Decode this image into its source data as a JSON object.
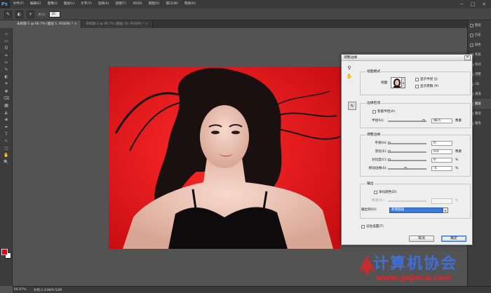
{
  "app": {
    "logo": "Ps"
  },
  "menu": [
    "文件(F)",
    "编辑(E)",
    "图像(I)",
    "图层(L)",
    "文字(Y)",
    "选择(S)",
    "滤镜(T)",
    "3D(D)",
    "视图(V)",
    "窗口(W)",
    "帮助(H)"
  ],
  "window_controls": [
    "−",
    "□",
    "×"
  ],
  "options": {
    "size_label": "大小:",
    "size_value": "35"
  },
  "tabs": [
    {
      "label": "未标题-1 @ 66.7% (图层 1, RGB/8) * ×"
    },
    {
      "label": "未标题-2 @ 66.7% (图层 10, RGB/8) * ×"
    }
  ],
  "tools": [
    "⊹",
    "▭",
    "ʘ",
    "⌗",
    "✂",
    "✎",
    "◐",
    "✦",
    "✚",
    "⌫",
    "▦",
    "◭",
    "◈",
    "✒",
    "T",
    "↖",
    "▢",
    "✋",
    "🔍"
  ],
  "panels": [
    {
      "label": "图层",
      "highlight": false
    },
    {
      "label": "历史",
      "highlight": false
    },
    {
      "label": "颜色",
      "highlight": false
    },
    {
      "label": "色板",
      "highlight": false
    },
    {
      "label": "样式",
      "highlight": false
    },
    {
      "label": "调整",
      "highlight": false
    },
    {
      "label": "3D",
      "highlight": false
    },
    {
      "label": "通道",
      "highlight": false
    },
    {
      "label": "图层",
      "highlight": true
    },
    {
      "label": "路径",
      "highlight": false
    },
    {
      "label": "属性",
      "highlight": false
    }
  ],
  "status": {
    "zoom": "66.67%",
    "doc": "文档:2.43M/9.52M"
  },
  "watermark": {
    "title": "计算机协会",
    "url": "www.gxjmca.com"
  },
  "dialog": {
    "title": "调整边缘",
    "close": "×",
    "view_mode": {
      "title": "视图模式",
      "view_label": "视图:",
      "show_radius": "显示半径 (J)",
      "show_original": "显示原稿 (P)"
    },
    "edge_detection": {
      "title": "边缘检测",
      "smart_radius": "智能半径(A)",
      "radius_label": "半径(U):",
      "radius_value": "98.5",
      "radius_unit": "像素",
      "radius_level": 0.97
    },
    "adjust_edge": {
      "title": "调整边缘",
      "rows": [
        {
          "label": "平滑(H):",
          "value": "0",
          "unit": "",
          "level": 0.0
        },
        {
          "label": "羽化(E):",
          "value": "0.0",
          "unit": "像素",
          "level": 0.0
        },
        {
          "label": "对比度(C):",
          "value": "0",
          "unit": "%",
          "level": 0.0
        },
        {
          "label": "移动边缘(S):",
          "value": "-5",
          "unit": "%",
          "level": 0.45
        }
      ]
    },
    "output": {
      "title": "输出",
      "decontaminate": "净化颜色(D)",
      "amount_label": "数量(N):",
      "amount_unit": "%",
      "output_to_label": "输出到(O):",
      "output_to_value": "新建图层"
    },
    "remember": "记住设置(T)",
    "cancel": "取消",
    "ok": "确定"
  }
}
